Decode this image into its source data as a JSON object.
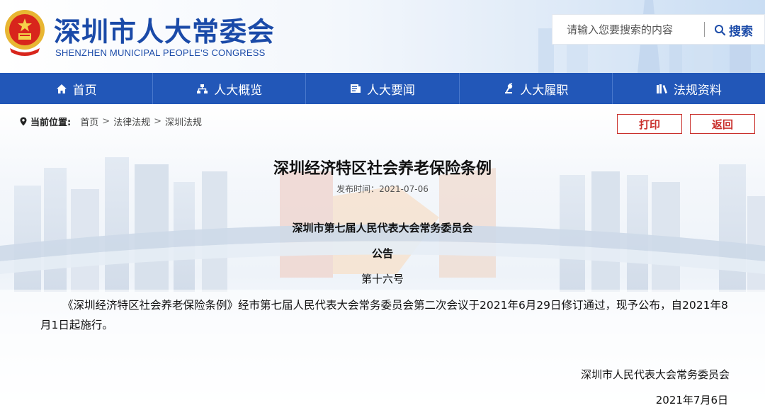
{
  "header": {
    "site_title": "深圳市人大常委会",
    "site_subtitle": "SHENZHEN MUNICIPAL PEOPLE'S CONGRESS",
    "emblem_icon": "national-emblem-icon",
    "search": {
      "placeholder": "请输入您要搜索的内容",
      "button_label": "搜索",
      "icon": "search-icon"
    }
  },
  "nav": {
    "items": [
      {
        "label": "首页",
        "icon": "home-icon"
      },
      {
        "label": "人大概览",
        "icon": "org-chart-icon"
      },
      {
        "label": "人大要闻",
        "icon": "news-icon"
      },
      {
        "label": "人大履职",
        "icon": "lamp-icon"
      },
      {
        "label": "法规资料",
        "icon": "books-icon"
      }
    ]
  },
  "breadcrumb": {
    "label": "当前位置:",
    "items": [
      "首页",
      "法律法规",
      "深圳法规"
    ],
    "separator": ">"
  },
  "actions": {
    "print_label": "打印",
    "back_label": "返回"
  },
  "article": {
    "title": "深圳经济特区社会养老保险条例",
    "publish_time": "发布时间：2021-07-06",
    "issuer": "深圳市第七届人民代表大会常务委员会",
    "notice": "公告",
    "number": "第十六号",
    "body": "《深圳经济特区社会养老保险条例》经市第七届人民代表大会常务委员会第二次会议于2021年6月29日修订通过，现予公布，自2021年8月1日起施行。",
    "sign_org": "深圳市人民代表大会常务委员会",
    "sign_date": "2021年7月6日"
  },
  "colors": {
    "brand_blue": "#2257b8",
    "title_blue": "#1a4aa8",
    "action_red": "#c9302c"
  }
}
